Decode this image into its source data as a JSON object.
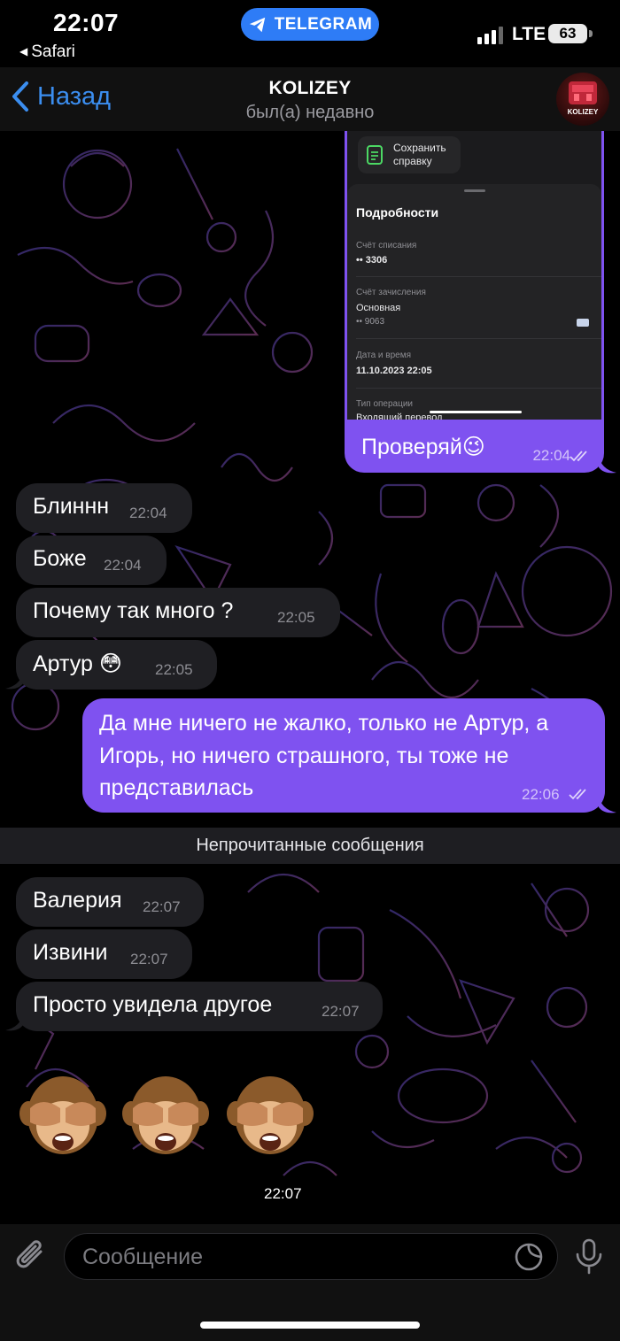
{
  "status_bar": {
    "time": "22:07",
    "back_app": "Safari",
    "app_pill": "TELEGRAM",
    "network": "LTE",
    "battery": "63"
  },
  "header": {
    "back_label": "Назад",
    "title": "KOLIZEY",
    "subtitle": "был(а) недавно",
    "avatar_text": "KOLIZEY"
  },
  "attachment": {
    "save_label": "Сохранить справку",
    "sheet_title": "Подробности",
    "fields": [
      {
        "label": "Счёт списания",
        "value": "•• 3306"
      },
      {
        "label": "Счёт зачисления",
        "value": "Основная",
        "extra": "•• 9063"
      },
      {
        "label": "Дата и время",
        "value": "11.10.2023 22:05"
      },
      {
        "label": "Тип операции",
        "value": "Входящий перевод"
      }
    ],
    "caption": "Проверяй😉",
    "time": "22:04"
  },
  "messages_in_1": [
    {
      "text": "Блиннн",
      "time": "22:04"
    },
    {
      "text": "Боже",
      "time": "22:04"
    },
    {
      "text": "Почему так много ?",
      "time": "22:05"
    },
    {
      "text": "Артур 😳",
      "time": "22:05"
    }
  ],
  "message_out": {
    "text": "Да мне ничего не жалко, только не Артур, а Игорь, но ничего страшного, ты тоже не представилась",
    "time": "22:06"
  },
  "unread_divider": "Непрочитанные сообщения",
  "messages_in_2": [
    {
      "text": "Валерия",
      "time": "22:07"
    },
    {
      "text": "Извини",
      "time": "22:07"
    },
    {
      "text": "Просто увидела другое",
      "time": "22:07"
    }
  ],
  "emoji_message": {
    "emoji": "🙈🙈🙈",
    "time": "22:07"
  },
  "composer": {
    "placeholder": "Сообщение"
  },
  "colors": {
    "accent": "#3b8ef0",
    "outgoing_bubble": "#7f52f0",
    "incoming_bubble": "#1f1f23",
    "telegram_pill": "#2e7cf6"
  }
}
